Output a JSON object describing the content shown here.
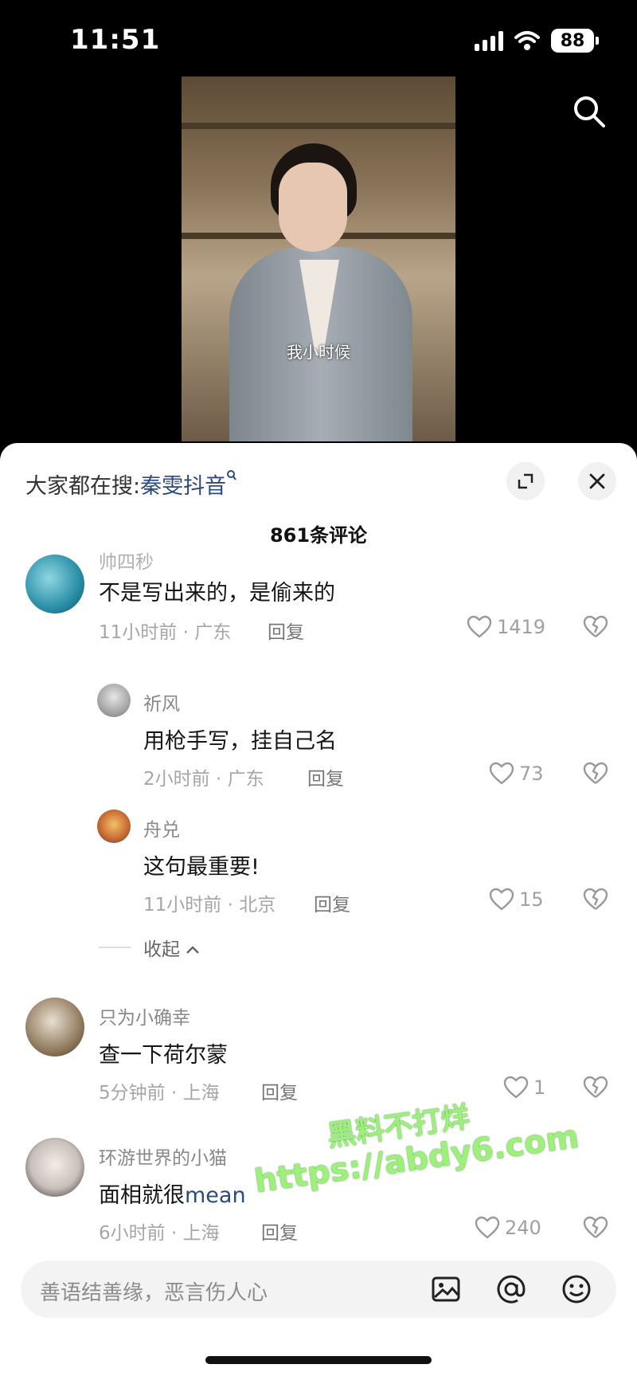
{
  "status_bar": {
    "time": "11:51",
    "battery": "88"
  },
  "video": {
    "caption": "我小时候"
  },
  "header": {
    "search_prefix": "大家都在搜:",
    "search_term": "秦雯抖音",
    "comment_count": "861条评论"
  },
  "comments": [
    {
      "name": "帅四秒",
      "text": "不是写出来的，是偷来的",
      "meta": "11小时前 · 广东",
      "reply": "回复",
      "likes": "1419"
    },
    {
      "name": "祈风",
      "text": "用枪手写，挂自己名",
      "meta": "2小时前 · 广东",
      "reply": "回复",
      "likes": "73"
    },
    {
      "name": "舟兑",
      "text": "这句最重要!",
      "meta": "11小时前 · 北京",
      "reply": "回复",
      "likes": "15"
    },
    {
      "name": "只为小确幸",
      "text": "查一下荷尔蒙",
      "meta": "5分钟前 · 上海",
      "reply": "回复",
      "likes": "1"
    },
    {
      "name": "环游世界的小猫",
      "text_prefix": "面相就很",
      "text_link": "mean",
      "meta": "6小时前 · 上海",
      "reply": "回复",
      "likes": "240"
    }
  ],
  "fold": {
    "label": "收起"
  },
  "watermark": {
    "line1": "黑料不打烊",
    "line2": "https://abdy6.com"
  },
  "input": {
    "placeholder": "善语结善缘，恶言伤人心"
  },
  "colors": {
    "link": "#2c4b7d",
    "watermark": "#9df07a"
  },
  "icons": [
    "search-icon",
    "expand-icon",
    "close-icon",
    "heart-icon",
    "broken-heart-icon",
    "image-icon",
    "at-icon",
    "emoji-icon"
  ]
}
